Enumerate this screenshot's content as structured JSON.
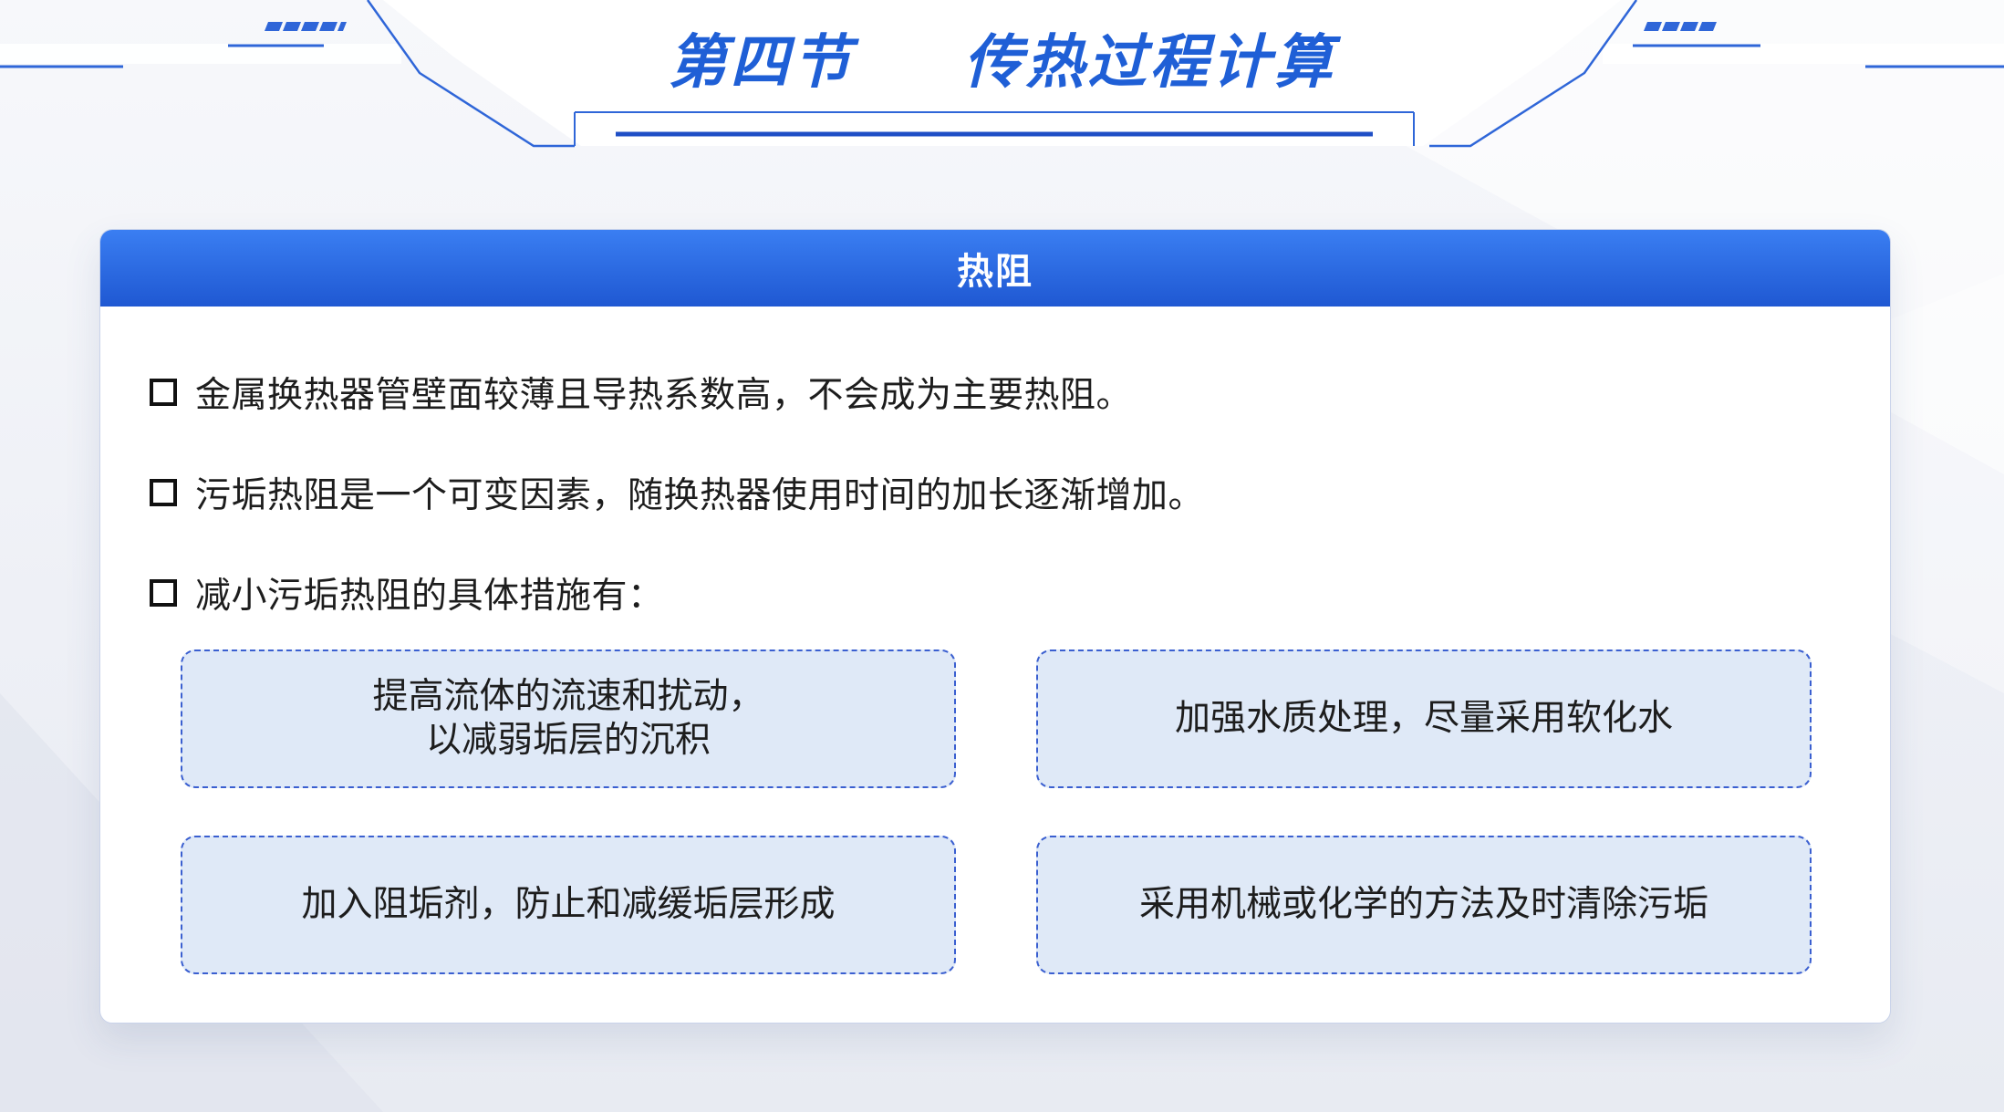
{
  "header": {
    "section_label": "第四节",
    "title": "传热过程计算"
  },
  "card": {
    "title": "热阻",
    "bullets": [
      "金属换热器管壁面较薄且导热系数高，不会成为主要热阻。",
      "污垢热阻是一个可变因素，随换热器使用时间的加长逐渐增加。",
      "减小污垢热阻的具体措施有："
    ],
    "measures": [
      "提高流体的流速和扰动，\n以减弱垢层的沉积",
      "加强水质处理，尽量采用软化水",
      "加入阻垢剂，防止和减缓垢层形成",
      "采用机械或化学的方法及时清除污垢"
    ]
  },
  "colors": {
    "accent": "#1f5fd6",
    "header_bar_top": "#3a7ef2",
    "header_bar_bottom": "#1f58d2",
    "measure_fill": "#dfe9f7",
    "measure_border": "#3a5fd0"
  }
}
